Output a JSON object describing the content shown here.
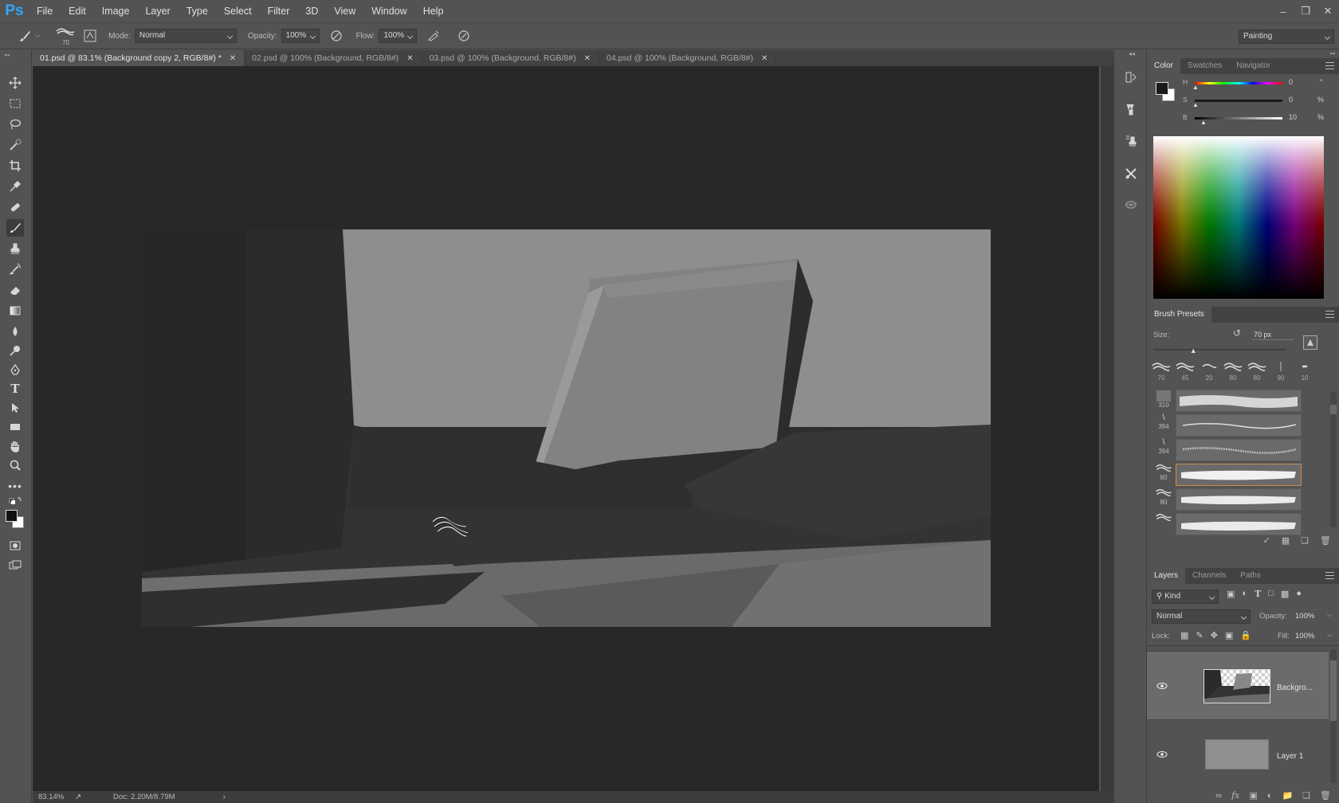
{
  "app": {
    "logo": "Ps"
  },
  "menu": [
    "File",
    "Edit",
    "Image",
    "Layer",
    "Type",
    "Select",
    "Filter",
    "3D",
    "View",
    "Window",
    "Help"
  ],
  "window_controls": [
    "minimize-icon",
    "restore-icon",
    "close-icon"
  ],
  "options_bar": {
    "brush_size": "70",
    "mode_label": "Mode:",
    "mode_value": "Normal",
    "opacity_label": "Opacity:",
    "opacity_value": "100%",
    "flow_label": "Flow:",
    "flow_value": "100%",
    "workspace": "Painting"
  },
  "tabs": [
    {
      "label": "01.psd @ 83.1% (Background copy 2, RGB/8#) *",
      "active": true
    },
    {
      "label": "02.psd @ 100% (Background, RGB/8#)",
      "active": false
    },
    {
      "label": "03.psd @ 100% (Background, RGB/8#)",
      "active": false
    },
    {
      "label": "04.psd @ 100% (Background, RGB/8#)",
      "active": false
    }
  ],
  "status": {
    "zoom": "83.14%",
    "doc": "Doc: 2.20M/8.79M"
  },
  "color_panel": {
    "tabs": [
      "Color",
      "Swatches",
      "Navigator"
    ],
    "h_label": "H",
    "h_value": "0",
    "h_unit": "°",
    "s_label": "S",
    "s_value": "0",
    "s_unit": "%",
    "b_label": "B",
    "b_value": "10",
    "b_unit": "%",
    "foreground": "#1a1a1a",
    "background": "#ffffff"
  },
  "brush_presets": {
    "title": "Brush Presets",
    "size_label": "Size:",
    "size_value": "70 px",
    "size_level": 0.3,
    "recent_sizes": [
      "70",
      "45",
      "20",
      "80",
      "80",
      "90",
      "10"
    ],
    "list_sizes": [
      "310",
      "394",
      "394",
      "80",
      "80",
      ""
    ]
  },
  "layers_panel": {
    "tabs": [
      "Layers",
      "Channels",
      "Paths"
    ],
    "kind_label": "Kind",
    "blend_mode": "Normal",
    "opacity_label": "Opacity:",
    "opacity_value": "100%",
    "lock_label": "Lock:",
    "fill_label": "Fill:",
    "fill_value": "100%",
    "layers": [
      {
        "name": "Backgro...",
        "visible": true,
        "selected": true
      },
      {
        "name": "Layer 1",
        "visible": true,
        "selected": false
      }
    ]
  }
}
